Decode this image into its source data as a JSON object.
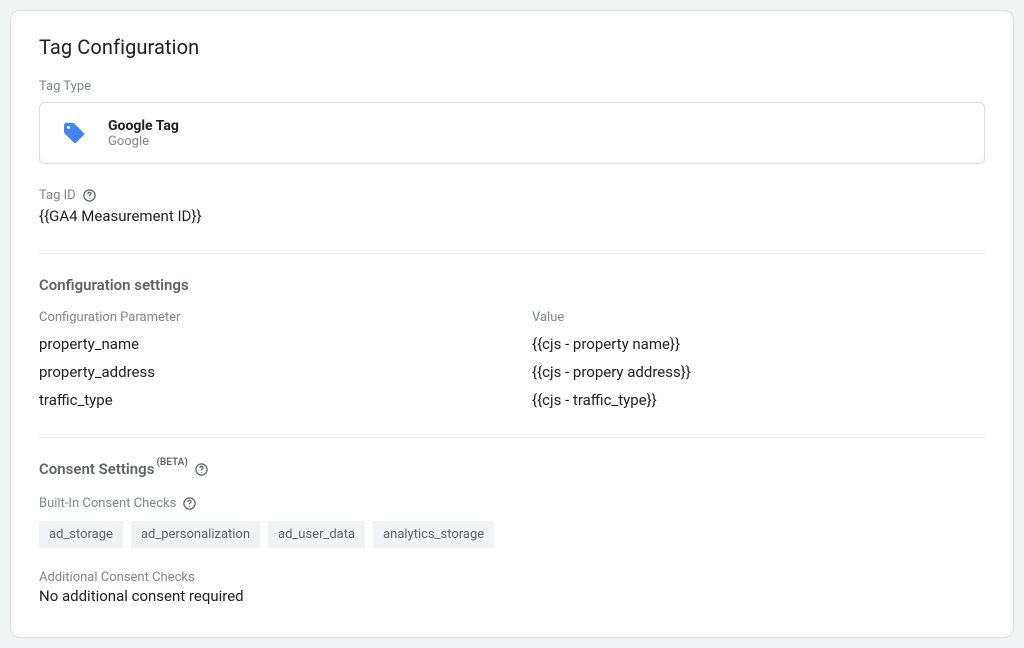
{
  "card": {
    "title": "Tag Configuration"
  },
  "tagType": {
    "label": "Tag Type",
    "name": "Google Tag",
    "vendor": "Google"
  },
  "tagId": {
    "label": "Tag ID",
    "value": "{{GA4 Measurement ID}}"
  },
  "configSettings": {
    "title": "Configuration settings",
    "colParam": "Configuration Parameter",
    "colValue": "Value",
    "rows": [
      {
        "param": "property_name",
        "value": "{{cjs - property name}}"
      },
      {
        "param": "property_address",
        "value": "{{cjs - propery address}}"
      },
      {
        "param": "traffic_type",
        "value": "{{cjs - traffic_type}}"
      }
    ]
  },
  "consent": {
    "title": "Consent Settings",
    "beta": "(BETA)",
    "builtInLabel": "Built-In Consent Checks",
    "chips": [
      "ad_storage",
      "ad_personalization",
      "ad_user_data",
      "analytics_storage"
    ],
    "additionalLabel": "Additional Consent Checks",
    "additionalValue": "No additional consent required"
  }
}
